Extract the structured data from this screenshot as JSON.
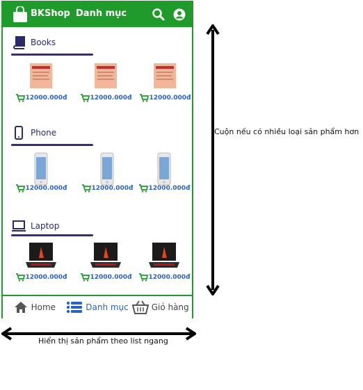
{
  "app": {
    "brand": "BKShop",
    "title": "Danh mục",
    "search_icon": "search-icon",
    "account_icon": "account-icon",
    "accent": "#1e9b2a",
    "link_color": "#2a62c8"
  },
  "sections": [
    {
      "label": "Books",
      "icon": "book-icon",
      "products": [
        {
          "price": "12000.000đ"
        },
        {
          "price": "12000.000đ"
        },
        {
          "price": "12000.000đ"
        }
      ]
    },
    {
      "label": "Phone",
      "icon": "phone-icon",
      "products": [
        {
          "price": "12000.000đ"
        },
        {
          "price": "12000.000đ"
        },
        {
          "price": "12000.000đ"
        }
      ]
    },
    {
      "label": "Laptop",
      "icon": "laptop-icon",
      "products": [
        {
          "price": "12000.000đ"
        },
        {
          "price": "12000.000đ"
        },
        {
          "price": "12000.000đ"
        }
      ]
    }
  ],
  "bottom_nav": [
    {
      "label": "Home",
      "icon": "home-icon"
    },
    {
      "label": "Danh mục",
      "icon": "list-icon"
    },
    {
      "label": "Giỏ hàng",
      "icon": "basket-icon"
    }
  ],
  "annotations": {
    "vertical": "Cuộn nếu có nhiều loại sản phẩm hơn",
    "horizontal": "Hiển thị sản phẩm theo list ngang"
  }
}
